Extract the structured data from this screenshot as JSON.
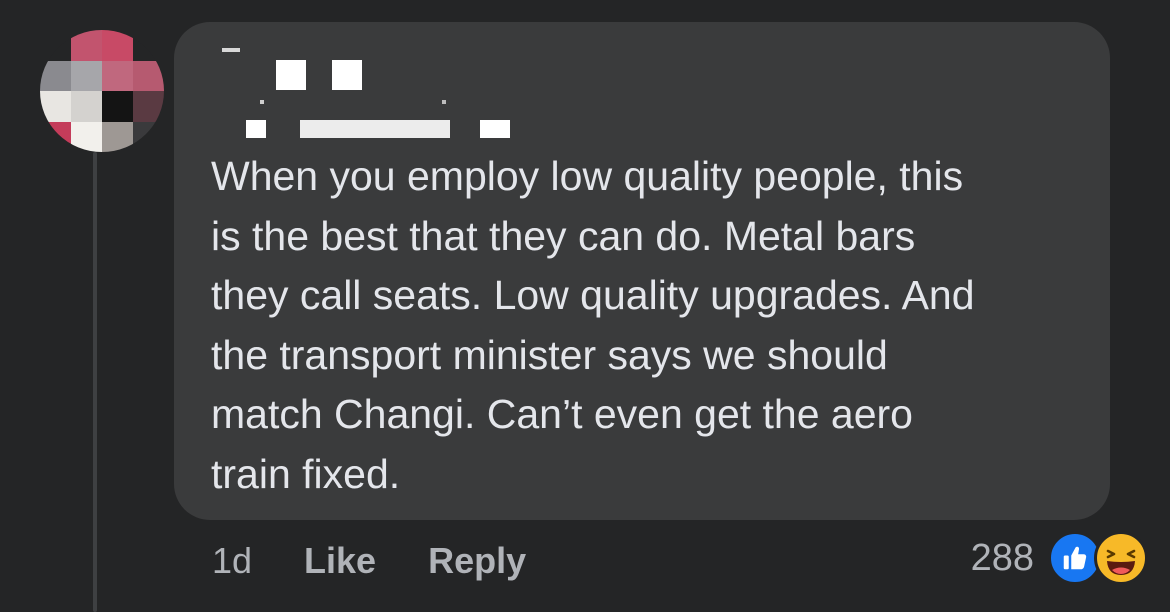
{
  "comment": {
    "text": "When you employ low quality people, this\nis the best that they can do. Metal bars\nthey call seats. Low quality upgrades. And\nthe transport minister says we should\nmatch Changi. Can’t even get the aero\ntrain fixed."
  },
  "actions": {
    "time": "1d",
    "like_label": "Like",
    "reply_label": "Reply"
  },
  "reactions": {
    "count": "288",
    "icons": [
      "like-icon",
      "haha-icon"
    ]
  },
  "colors": {
    "background": "#242526",
    "bubble": "#3a3b3c",
    "text": "#e4e6eb",
    "secondary_text": "#b0b3b8",
    "like_blue": "#1877f2",
    "haha_yellow": "#f7b928"
  }
}
